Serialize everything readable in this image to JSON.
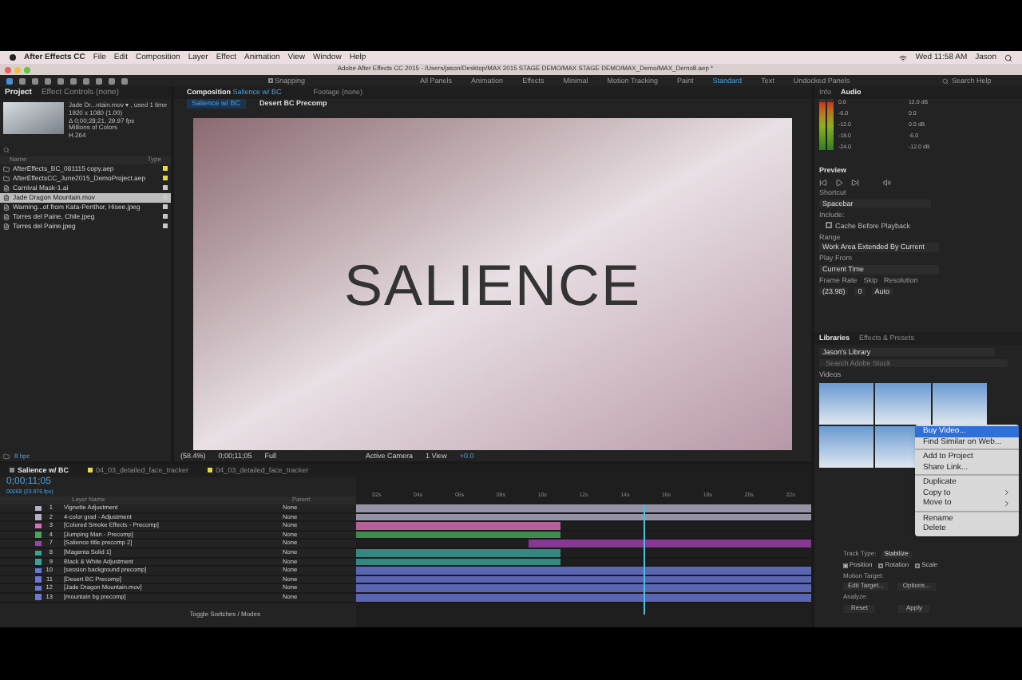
{
  "menubar": {
    "app": "After Effects CC",
    "items": [
      "File",
      "Edit",
      "Composition",
      "Layer",
      "Effect",
      "Animation",
      "View",
      "Window",
      "Help"
    ],
    "clock": "Wed 11:58 AM",
    "user": "Jason"
  },
  "window": {
    "title": "Adobe After Effects CC 2015 - /Users/jason/Desktop/MAX 2015 STAGE DEMO/MAX STAGE DEMO/MAX_Demo/MAX_Demo8.aep *"
  },
  "toolbar": {
    "snapping": {
      "label": "Snapping",
      "checked": false
    },
    "workspaces": [
      {
        "label": "All Panels",
        "selected": false
      },
      {
        "label": "Animation",
        "selected": false
      },
      {
        "label": "Effects",
        "selected": false
      },
      {
        "label": "Minimal",
        "selected": false
      },
      {
        "label": "Motion Tracking",
        "selected": false
      },
      {
        "label": "Paint",
        "selected": false
      },
      {
        "label": "Standard",
        "selected": true
      },
      {
        "label": "Text",
        "selected": false
      },
      {
        "label": "Undocked Panels",
        "selected": false
      }
    ],
    "search_placeholder": "Search Help"
  },
  "project": {
    "tabs": [
      {
        "label": "Project",
        "selected": true
      },
      {
        "label": "Effect Controls (none)",
        "selected": false
      }
    ],
    "preview_lines": [
      "Jade Dr...ntain.mov ▾ , used 1 time",
      "1920 x 1080 (1.00)",
      "Δ 0;00;28;21, 29.97 fps",
      "Millions of Colors",
      "H.264"
    ],
    "columns": [
      "Name",
      "Type"
    ],
    "items": [
      {
        "name": "AfterEffects_BC_081115 copy.aep",
        "kind": "aep",
        "selected": false,
        "color": "#e8d84a"
      },
      {
        "name": "AfterEffectsCC_June2015_DemoProject.aep",
        "kind": "aep",
        "selected": false,
        "color": "#e8d84a"
      },
      {
        "name": "Carnival Mask-1.ai",
        "kind": "file",
        "selected": false,
        "color": "#c8c8c8"
      },
      {
        "name": "Jade Dragon Mountain.mov",
        "kind": "file",
        "selected": true,
        "color": "#c8c8c8"
      },
      {
        "name": "Warning...ot from Kata-Penthor, Hisee.jpeg",
        "kind": "file",
        "selected": false,
        "color": "#c8c8c8"
      },
      {
        "name": "Torres del Paine, Chile.jpeg",
        "kind": "file",
        "selected": false,
        "color": "#c8c8c8"
      },
      {
        "name": "Torres del Paine.jpeg",
        "kind": "file",
        "selected": false,
        "color": "#c8c8c8"
      }
    ],
    "bit_depth": "8 bpc"
  },
  "composition": {
    "tabs": [
      {
        "label": "Composition",
        "name": "Salience w/ BC",
        "selected": true
      },
      {
        "label": "Footage (none)",
        "selected": false
      }
    ],
    "breadcrumbs": [
      {
        "label": "Salience w/ BC",
        "selected": true
      },
      {
        "label": "Desert BC Precomp",
        "selected": false
      }
    ],
    "title_overlay": "SALIENCE",
    "footer": {
      "zoom": "(58.4%)",
      "timecode": "0;00;11;05",
      "resolution": "Full",
      "camera": "Active Camera",
      "views": "1 View",
      "exposure": "+0.0"
    }
  },
  "info_audio": {
    "tabs": [
      {
        "label": "Info",
        "selected": false
      },
      {
        "label": "Audio",
        "selected": true
      }
    ],
    "left_scale": [
      "0.0",
      "-6.0",
      "-12.0",
      "-18.0",
      "-24.0"
    ],
    "right_scale": [
      "12.0 dB",
      "0.0",
      "0.0 dB",
      "-6.0",
      "-12.0 dB"
    ],
    "meters": [
      {
        "level": 0.95
      },
      {
        "level": 0.95
      }
    ]
  },
  "preview": {
    "title": "Preview",
    "shortcut_label": "Shortcut",
    "shortcut": "Spacebar",
    "include_label": "Include:",
    "cache": {
      "label": "Cache Before Playback",
      "checked": false
    },
    "range_label": "Range",
    "range": "Work Area Extended By Current",
    "play_from_label": "Play From",
    "play_from": "Current Time",
    "frame_rate_label": "Frame Rate",
    "skip_label": "Skip",
    "resolution_label": "Resolution",
    "frame_rate": "(23.98)",
    "skip": "0",
    "resolution": "Auto"
  },
  "libraries": {
    "tabs": [
      {
        "label": "Libraries",
        "selected": true
      },
      {
        "label": "Effects & Presets",
        "selected": false
      }
    ],
    "library": "Jason's Library",
    "search_placeholder": "Search Adobe Stock",
    "section": "Videos"
  },
  "context_menu": {
    "groups": [
      [
        {
          "label": "Buy Video...",
          "selected": true,
          "submenu": false
        },
        {
          "label": "Find Similar on Web...",
          "selected": false,
          "submenu": false
        }
      ],
      [
        {
          "label": "Add to Project",
          "selected": false,
          "submenu": false
        },
        {
          "label": "Share Link...",
          "selected": false,
          "submenu": false
        }
      ],
      [
        {
          "label": "Duplicate",
          "selected": false,
          "submenu": false
        },
        {
          "label": "Copy to",
          "selected": false,
          "submenu": true
        },
        {
          "label": "Move to",
          "selected": false,
          "submenu": true
        }
      ],
      [
        {
          "label": "Rename",
          "selected": false,
          "submenu": false
        },
        {
          "label": "Delete",
          "selected": false,
          "submenu": false
        }
      ]
    ]
  },
  "tracker": {
    "track_type_label": "Track Type:",
    "track_type": "Stabilize",
    "options": [
      {
        "label": "Position",
        "checked": true
      },
      {
        "label": "Rotation",
        "checked": false
      },
      {
        "label": "Scale",
        "checked": false
      }
    ],
    "motion_target_label": "Motion Target:",
    "buttons": [
      "Edit Target...",
      "Options..."
    ],
    "analyze_label": "Analyze:",
    "bottom_buttons": [
      "Reset",
      "Apply"
    ]
  },
  "timeline": {
    "tabs": [
      {
        "label": "Salience w/ BC",
        "selected": true,
        "color": "#8a8a8a"
      },
      {
        "label": "04_03_detailed_face_tracker",
        "selected": false,
        "color": "#e8d84a"
      },
      {
        "label": "04_03_detailed_face_tracker",
        "selected": false,
        "color": "#e8d84a"
      }
    ],
    "timecode": "0;00;11;05",
    "frame_info": "00269 (23.976 fps)",
    "columns": {
      "name": "Layer Name",
      "parent": "Parent"
    },
    "ruler": [
      "02s",
      "04s",
      "06s",
      "08s",
      "10s",
      "12s",
      "14s",
      "16s",
      "18s",
      "20s",
      "22s"
    ],
    "layers": [
      {
        "number": "1",
        "name": "Vignette Adjustment",
        "parent": "None",
        "color": "#b4b0c8",
        "kind": "full"
      },
      {
        "number": "2",
        "name": "4-color grad - Adjustment",
        "parent": "None",
        "color": "#b4b0c8",
        "kind": "full"
      },
      {
        "number": "3",
        "name": "[Colored Smoke Effects - Precomp]",
        "parent": "None",
        "color": "#d970b8",
        "kind": "early"
      },
      {
        "number": "4",
        "name": "[Jumping Man - Precomp]",
        "parent": "None",
        "color": "#4aa55a",
        "kind": "early"
      },
      {
        "number": "7",
        "name": "[Salience title precomp 2]",
        "parent": "None",
        "color": "#a040b0",
        "kind": "late"
      },
      {
        "number": "8",
        "name": "[Magenta Solid 1]",
        "parent": "None",
        "color": "#3aa39a",
        "kind": "early"
      },
      {
        "number": "9",
        "name": "Black & White Adjustment",
        "parent": "None",
        "color": "#3aa39a",
        "kind": "early"
      },
      {
        "number": "10",
        "name": "[session background precomp]",
        "parent": "None",
        "color": "#6a78d8",
        "kind": "full"
      },
      {
        "number": "11",
        "name": "[Desert BC Precomp]",
        "parent": "None",
        "color": "#6a78d8",
        "kind": "full"
      },
      {
        "number": "12",
        "name": "[Jade Dragon Mountain.mov]",
        "parent": "None",
        "color": "#6a78d8",
        "kind": "full"
      },
      {
        "number": "13",
        "name": "[mountain bg precomp]",
        "parent": "None",
        "color": "#6a78d8",
        "kind": "full"
      }
    ],
    "footer": "Toggle Switches / Modes"
  }
}
